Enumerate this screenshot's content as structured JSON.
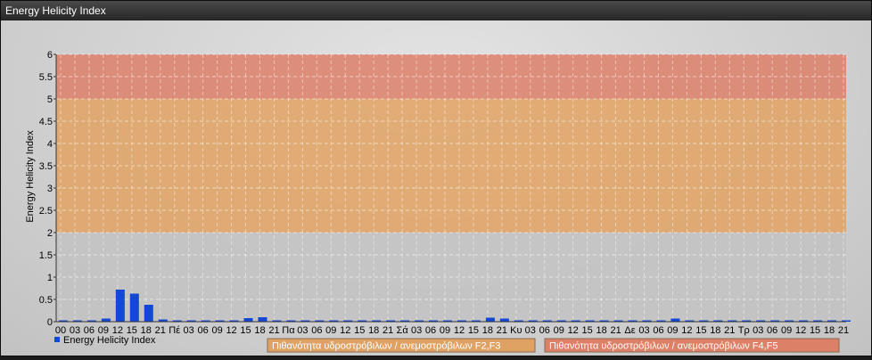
{
  "window": {
    "title": "Energy Helicity Index"
  },
  "chart_data": {
    "type": "bar",
    "ylabel": "Energy Helicity Index",
    "ylim": [
      0,
      6
    ],
    "yticks": [
      "0",
      "0.5",
      "1",
      "1.5",
      "2",
      "2.5",
      "3",
      "3.5",
      "4",
      "4.5",
      "5",
      "5.5",
      "6"
    ],
    "x_labels": [
      "00",
      "03",
      "06",
      "09",
      "12",
      "15",
      "18",
      "21",
      "Πέ",
      "03",
      "06",
      "09",
      "12",
      "15",
      "18",
      "21",
      "Πα",
      "03",
      "06",
      "09",
      "12",
      "15",
      "18",
      "21",
      "Σά",
      "03",
      "06",
      "09",
      "12",
      "15",
      "18",
      "21",
      "Κυ",
      "03",
      "06",
      "09",
      "12",
      "15",
      "18",
      "21",
      "Δε",
      "03",
      "06",
      "09",
      "12",
      "15",
      "18",
      "21",
      "Τρ",
      "03",
      "06",
      "09",
      "12",
      "15",
      "18",
      "21"
    ],
    "series": [
      {
        "name": "Energy Helicity Index",
        "values": [
          0,
          0,
          0,
          0.07,
          0.72,
          0.63,
          0.38,
          0.05,
          0,
          0,
          0,
          0,
          0.02,
          0.08,
          0.1,
          0.02,
          0,
          0,
          0,
          0,
          0,
          0,
          0,
          0,
          0,
          0,
          0,
          0,
          0,
          0.02,
          0.09,
          0.07,
          0,
          0,
          0,
          0,
          0,
          0,
          0.01,
          0,
          0,
          0,
          0,
          0.07,
          0,
          0,
          0,
          0,
          0,
          0,
          0,
          0,
          0,
          0,
          0,
          0
        ]
      }
    ],
    "bands": [
      {
        "from": 0,
        "to": 2,
        "color": "#c2c2c2"
      },
      {
        "from": 2,
        "to": 5,
        "color": "#e0a263",
        "label": "Πιθανότητα υδροστρόβιλων / ανεμοστρόβιλων F2,F3"
      },
      {
        "from": 5,
        "to": 6,
        "color": "#dd8068",
        "label": "Πιθανότητα υδροστρόβιλων / ανεμοστρόβιλων F4,F5"
      }
    ],
    "bar_color": "#1247d8",
    "grid": true,
    "legend": "bottom-left"
  }
}
